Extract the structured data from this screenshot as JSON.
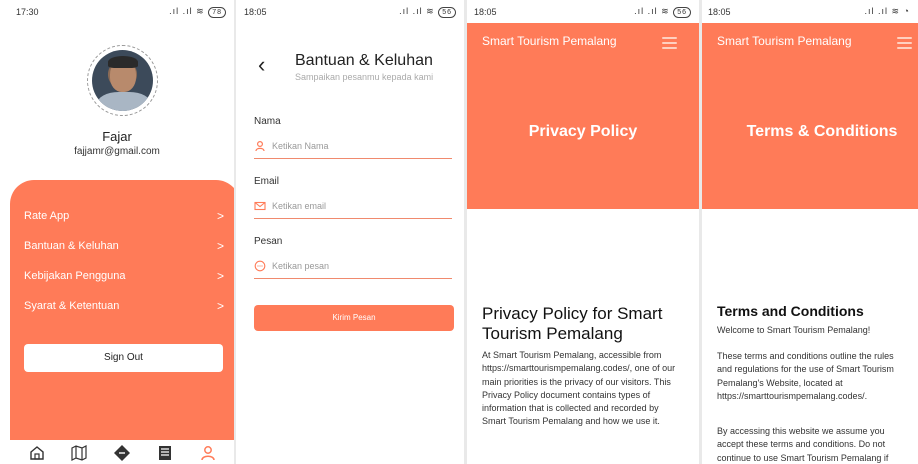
{
  "screen1": {
    "status": {
      "time": "17:30",
      "battery": "78"
    },
    "user": {
      "name": "Fajar",
      "email": "fajjamr@gmail.com"
    },
    "menu": [
      {
        "label": "Rate App"
      },
      {
        "label": "Bantuan & Keluhan"
      },
      {
        "label": "Kebijakan Pengguna"
      },
      {
        "label": "Syarat & Ketentuan"
      }
    ],
    "chevron": ">",
    "sign_out": "Sign Out",
    "nav": [
      "home-icon",
      "map-icon",
      "ticket-icon",
      "news-icon",
      "profile-icon"
    ],
    "colors": {
      "accent": "#ff7b58"
    }
  },
  "screen2": {
    "status": {
      "time": "18:05",
      "battery": "56"
    },
    "title": "Bantuan & Keluhan",
    "subtitle": "Sampaikan pesanmu kepada kami",
    "fields": [
      {
        "label": "Nama",
        "placeholder": "Ketikan Nama"
      },
      {
        "label": "Email",
        "placeholder": "Ketikan email"
      },
      {
        "label": "Pesan",
        "placeholder": "Ketikan pesan"
      }
    ],
    "submit": "Kirim Pesan"
  },
  "screen3": {
    "status": {
      "time": "18:05",
      "battery": "56"
    },
    "brand": "Smart Tourism Pemalang",
    "hero_title": "Privacy Policy",
    "heading": "Privacy Policy for Smart Tourism Pemalang",
    "body": "At Smart Tourism Pemalang, accessible from https://smarttourismpemalang.codes/, one of our main priorities is the privacy of our visitors. This Privacy Policy document contains types of information that is collected and recorded by Smart Tourism Pemalang and how we use it."
  },
  "screen4": {
    "status": {
      "time": "18:05"
    },
    "brand": "Smart Tourism Pemalang",
    "hero_title": "Terms & Conditions",
    "heading": "Terms and Conditions",
    "welcome": "Welcome to Smart Tourism Pemalang!",
    "para1": "These terms and conditions outline the rules and regulations for the use of Smart Tourism Pemalang's Website, located at https://smarttourismpemalang.codes/.",
    "para2": "By accessing this website we assume you accept these terms and conditions. Do not continue to use Smart Tourism Pemalang if"
  }
}
